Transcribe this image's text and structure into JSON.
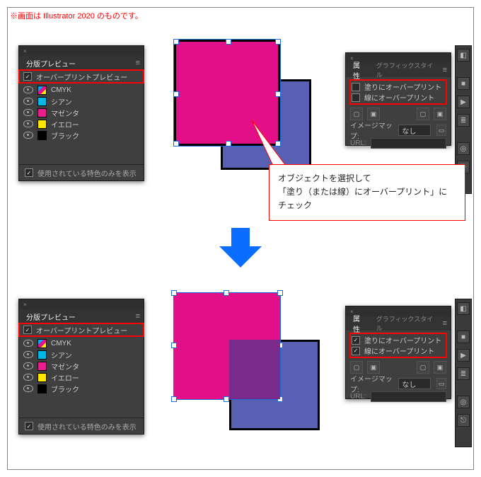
{
  "note": "※画面は Illustrator 2020 のものです。",
  "sep": {
    "title": "分版プレビュー",
    "overprint_preview": "オーバープリントプレビュー",
    "channels": [
      {
        "name": "CMYK",
        "color": "linear-gradient(135deg,#0ff 0 25%,#f0f 25% 50%,#ff0 50% 75%,#000 75% 100%)"
      },
      {
        "name": "シアン",
        "color": "#00b8e6"
      },
      {
        "name": "マゼンタ",
        "color": "#e91e8c"
      },
      {
        "name": "イエロー",
        "color": "#ffe600"
      },
      {
        "name": "ブラック",
        "color": "#000"
      }
    ],
    "show_only_used": "使用されている特色のみを表示"
  },
  "attr": {
    "tab_attr": "属性",
    "tab_gs": "グラフィックスタイル",
    "fill_op": "塗りにオーバープリント",
    "stroke_op": "線にオーバープリント",
    "imagemap_label": "イメージマップ:",
    "imagemap_value": "なし",
    "url_label": "URL:"
  },
  "callout": {
    "l1": "オブジェクトを選択して",
    "l2": "「塗り（または線）にオーバープリント」に",
    "l3": "チェック"
  },
  "states": {
    "top": {
      "op_preview": true,
      "fill_op": false,
      "stroke_op": false
    },
    "bottom": {
      "op_preview": true,
      "fill_op": true,
      "stroke_op": true
    }
  }
}
